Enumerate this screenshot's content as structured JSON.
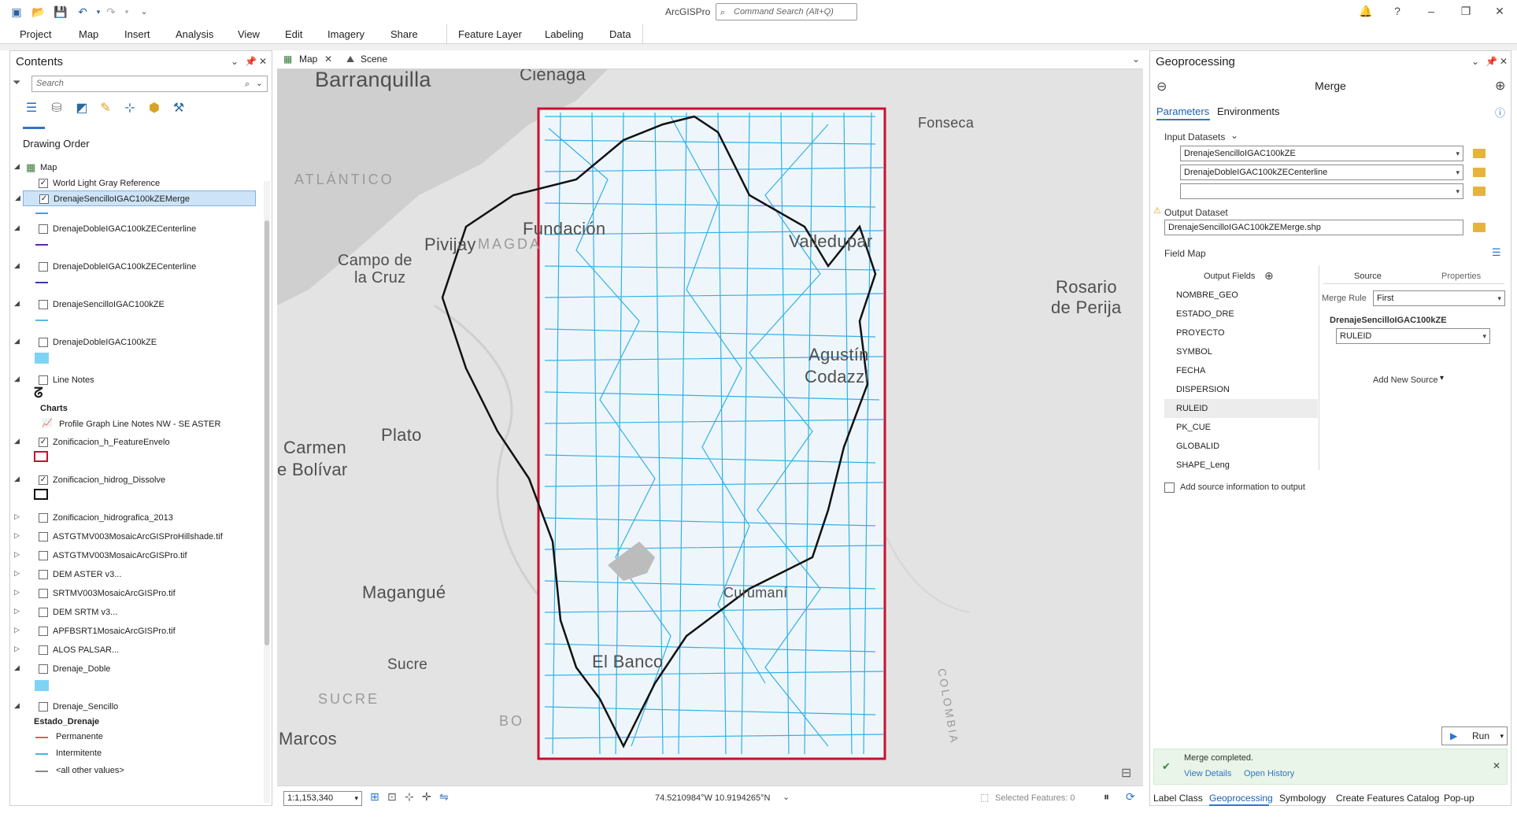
{
  "titlebar": {
    "app_title": "ArcGISPro",
    "command_search_placeholder": "Command Search (Alt+Q)"
  },
  "ribbon": {
    "tabs": [
      "Project",
      "Map",
      "Insert",
      "Analysis",
      "View",
      "Edit",
      "Imagery",
      "Share",
      "Feature Layer",
      "Labeling",
      "Data"
    ]
  },
  "contents": {
    "title": "Contents",
    "search_placeholder": "Search",
    "drawing_order": "Drawing Order",
    "items": [
      {
        "label": "Map",
        "checked": null
      },
      {
        "label": "World Light Gray Reference",
        "checked": true
      },
      {
        "label": "DrenajeSencilloIGAC100kZEMerge",
        "checked": true,
        "selected": true
      },
      {
        "label": "DrenajeDobleIGAC100kZECenterline",
        "checked": false
      },
      {
        "label": "DrenajeDobleIGAC100kZECenterline",
        "checked": false
      },
      {
        "label": "DrenajeSencilloIGAC100kZE",
        "checked": false
      },
      {
        "label": "DrenajeDobleIGAC100kZE",
        "checked": false
      },
      {
        "label": "Line Notes",
        "checked": false
      },
      {
        "label": "Charts",
        "checked": null
      },
      {
        "label": "Profile Graph Line Notes NW - SE ASTER",
        "checked": null
      },
      {
        "label": "Zonificacion_h_FeatureEnvelo",
        "checked": true
      },
      {
        "label": "Zonificacion_hidrog_Dissolve",
        "checked": true
      },
      {
        "label": "Zonificacion_hidrografica_2013",
        "checked": false
      },
      {
        "label": "ASTGTMV003MosaicArcGISProHillshade.tif",
        "checked": false
      },
      {
        "label": "ASTGTMV003MosaicArcGISPro.tif",
        "checked": false
      },
      {
        "label": "DEM ASTER v3...",
        "checked": false
      },
      {
        "label": "SRTMV003MosaicArcGISPro.tif",
        "checked": false
      },
      {
        "label": "DEM SRTM v3...",
        "checked": false
      },
      {
        "label": "APFBSRT1MosaicArcGISPro.tif",
        "checked": false
      },
      {
        "label": "ALOS PALSAR...",
        "checked": false
      },
      {
        "label": "Drenaje_Doble",
        "checked": false
      },
      {
        "label": "Drenaje_Sencillo",
        "checked": false
      },
      {
        "label": "Estado_Drenaje",
        "checked": null
      },
      {
        "label": "Permanente",
        "checked": null
      },
      {
        "label": "Intermitente",
        "checked": null
      },
      {
        "label": "<all other values>",
        "checked": null
      }
    ]
  },
  "map_view": {
    "tabs": [
      "Map",
      "Scene"
    ],
    "places": [
      "Barranquilla",
      "Ciénaga",
      "Fonseca",
      "ATLÁNTICO",
      "Fundación",
      "Pivijay",
      "MAGDA",
      "Campo de",
      "la Cruz",
      "Valledupar",
      "Rosario",
      "de Perija",
      "Agustín",
      "Codazzi",
      "Plato",
      "Carmen",
      "e Bolívar",
      "Magangué",
      "Curumaní",
      "Sucre",
      "SUCRE",
      "El Banco",
      "BO",
      "COLOMBIA",
      "Marcos"
    ],
    "scale": "1:1,153,340",
    "coordinates": "74.5210984°W 10.9194265°N",
    "selected_features": "Selected Features: 0"
  },
  "geoprocessing": {
    "title": "Geoprocessing",
    "tool": "Merge",
    "tabs": [
      "Parameters",
      "Environments"
    ],
    "input_datasets_label": "Input Datasets",
    "input_datasets": [
      "DrenajeSencilloIGAC100kZE",
      "DrenajeDobleIGAC100kZECenterline",
      ""
    ],
    "output_dataset_label": "Output Dataset",
    "output_dataset": "DrenajeSencilloIGAC100kZEMerge.shp",
    "field_map_label": "Field Map",
    "output_fields_label": "Output Fields",
    "source_tab": "Source",
    "properties_tab": "Properties",
    "fields": [
      "NOMBRE_GEO",
      "ESTADO_DRE",
      "PROYECTO",
      "SYMBOL",
      "FECHA",
      "DISPERSION",
      "RULEID",
      "PK_CUE",
      "GLOBALID",
      "SHAPE_Leng"
    ],
    "merge_rule_label": "Merge Rule",
    "merge_rule": "First",
    "source_dataset": "DrenajeSencilloIGAC100kZE",
    "source_field": "RULEID",
    "add_new_source": "Add New Source",
    "add_source_info": "Add source information to output",
    "run_label": "Run",
    "message": "Merge completed.",
    "view_details": "View Details",
    "open_history": "Open History"
  },
  "bottom_tabs": [
    "Label Class",
    "Geoprocessing",
    "Symbology",
    "Create Features",
    "Catalog",
    "Pop-up"
  ]
}
